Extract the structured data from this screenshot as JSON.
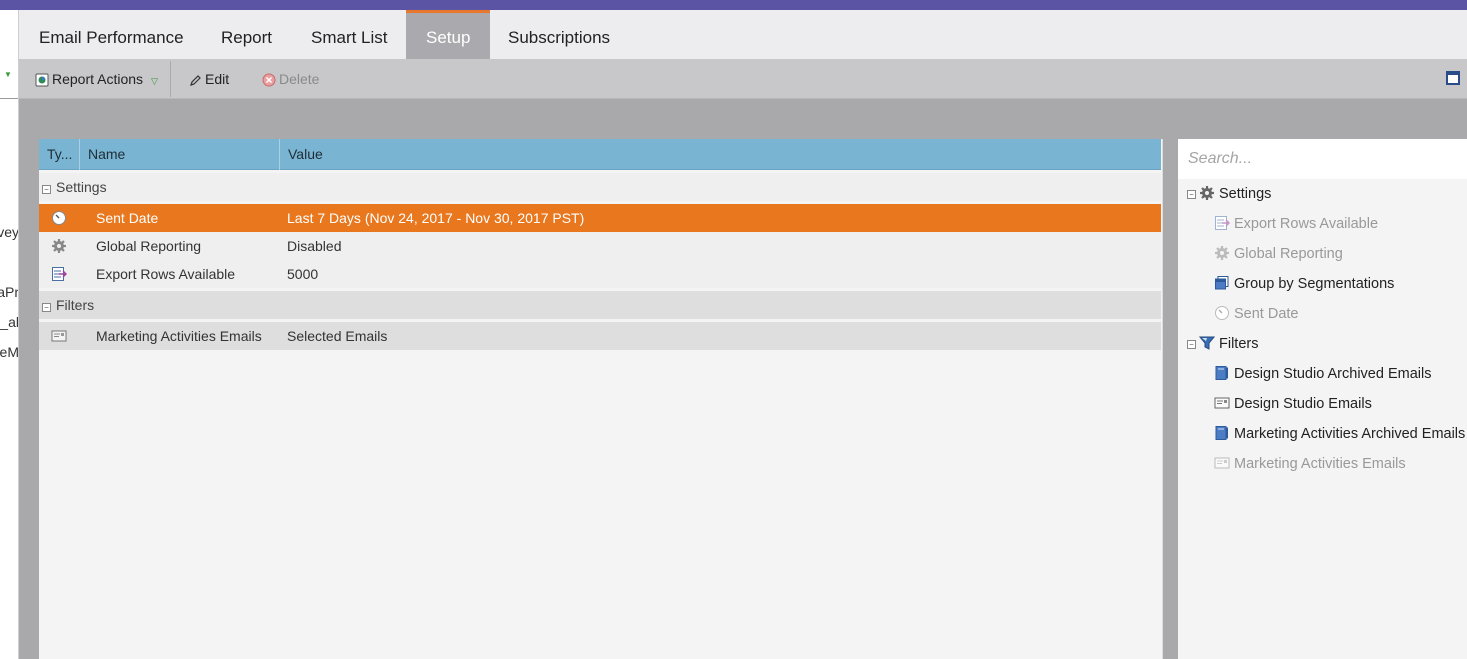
{
  "left_strip": {
    "fragments": [
      "vey",
      "aPr",
      "al_",
      "eM"
    ]
  },
  "tabs": [
    {
      "label": "Email Performance",
      "active": false
    },
    {
      "label": "Report",
      "active": false
    },
    {
      "label": "Smart List",
      "active": false
    },
    {
      "label": "Setup",
      "active": true
    },
    {
      "label": "Subscriptions",
      "active": false
    }
  ],
  "toolbar": {
    "report_actions_label": "Report Actions",
    "edit_label": "Edit",
    "delete_label": "Delete"
  },
  "grid": {
    "columns": [
      "Ty...",
      "Name",
      "Value"
    ],
    "groups": [
      {
        "label": "Settings",
        "rows": [
          {
            "icon": "clock-icon",
            "name": "Sent Date",
            "value": "Last 7 Days (Nov 24, 2017 - Nov 30, 2017 PST)",
            "selected": true
          },
          {
            "icon": "gear-icon",
            "name": "Global Reporting",
            "value": "Disabled",
            "selected": false
          },
          {
            "icon": "export-rows-icon",
            "name": "Export Rows Available",
            "value": "5000",
            "selected": false
          }
        ]
      },
      {
        "label": "Filters",
        "rows": [
          {
            "icon": "email-icon",
            "name": "Marketing Activities Emails",
            "value": "Selected Emails",
            "selected": false
          }
        ]
      }
    ]
  },
  "side_panel": {
    "search_placeholder": "Search...",
    "settings_label": "Settings",
    "settings_items": [
      {
        "label": "Export Rows Available",
        "icon": "export-rows-icon",
        "disabled": true
      },
      {
        "label": "Global Reporting",
        "icon": "gear-icon",
        "disabled": true
      },
      {
        "label": "Group by Segmentations",
        "icon": "segmentation-icon",
        "disabled": false
      },
      {
        "label": "Sent Date",
        "icon": "clock-icon",
        "disabled": true
      }
    ],
    "filters_label": "Filters",
    "filters_items": [
      {
        "label": "Design Studio Archived Emails",
        "icon": "archive-icon",
        "disabled": false
      },
      {
        "label": "Design Studio Emails",
        "icon": "email-icon",
        "disabled": false
      },
      {
        "label": "Marketing Activities Archived Emails",
        "icon": "archive-icon",
        "disabled": false
      },
      {
        "label": "Marketing Activities Emails",
        "icon": "email-icon",
        "disabled": true
      }
    ]
  },
  "colors": {
    "topbar": "#5b53a4",
    "active_tab_accent": "#e8772e",
    "selected_row": "#e8771e",
    "grid_header": "#7ab4d3"
  }
}
